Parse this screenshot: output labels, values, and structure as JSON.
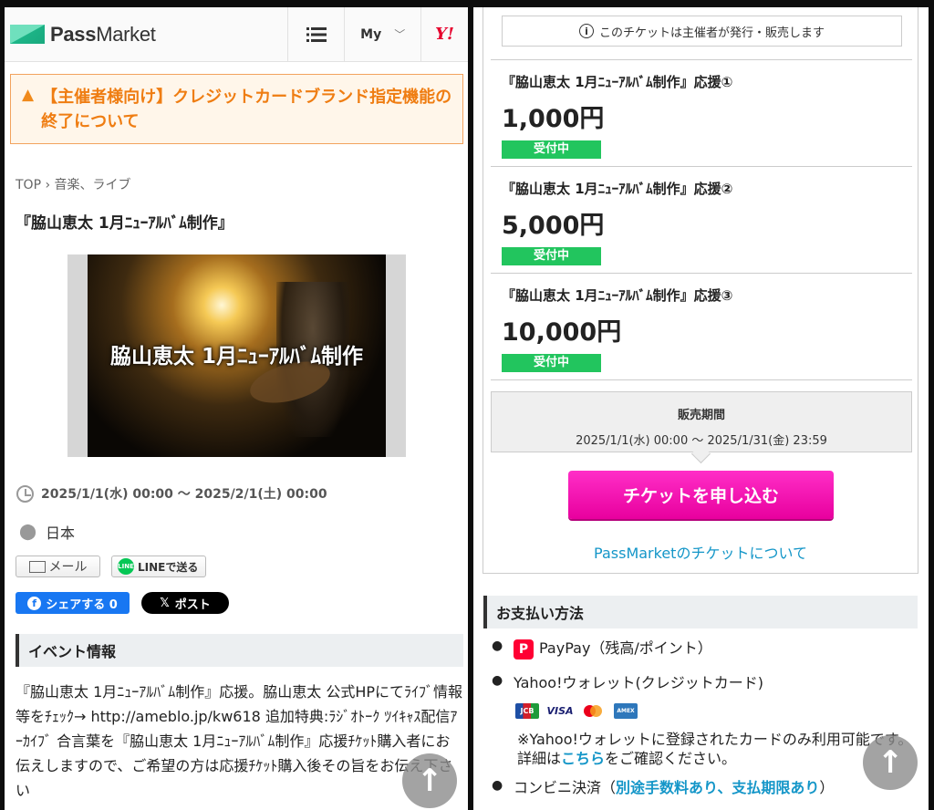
{
  "left": {
    "header": {
      "logo_bold": "Pass",
      "logo_regular": "Market",
      "menu_icon": "list-icon",
      "my_label": "My",
      "yahoo_label": "Y!"
    },
    "notice": "【主催者様向け】クレジットカードブランド指定機能の終了について",
    "breadcrumb": {
      "top": "TOP",
      "sep": "›",
      "category": "音楽、ライブ"
    },
    "event_title": "『脇山恵太 1月ﾆｭｰｱﾙﾊﾞﾑ制作』",
    "hero_caption": "脇山恵太 1月ﾆｭｰｱﾙﾊﾞﾑ制作",
    "datetime": "2025/1/1(水) 00:00 〜 2025/2/1(土) 00:00",
    "location": "日本",
    "share": {
      "mail": "メール",
      "line": "LINEで送る",
      "line_icon_text": "LINE",
      "facebook": "シェアする 0",
      "x": "ポスト"
    },
    "section_title": "イベント情報",
    "description": "『脇山恵太 1月ﾆｭｰｱﾙﾊﾞﾑ制作』応援。脇山恵太 公式HPにてﾗｲﾌﾞ情報等をﾁｪｯｸ→ http://ameblo.jp/kw618 追加特典:ﾗｼﾞｵﾄｰｸ ﾂｲｷｬｽ配信ｱｰｶｲﾌﾞ 合言葉を『脇山恵太 1月ﾆｭｰｱﾙﾊﾞﾑ制作』応援ﾁｹｯﾄ購入者にお伝えしますので、ご希望の方は応援ﾁｹｯﾄ購入後その旨をお伝え下さい"
  },
  "right": {
    "issuer_note": "このチケットは主催者が発行・販売します",
    "tickets": [
      {
        "name": "『脇山恵太 1月ﾆｭｰｱﾙﾊﾞﾑ制作』応援①",
        "price": "1,000円",
        "status": "受付中"
      },
      {
        "name": "『脇山恵太 1月ﾆｭｰｱﾙﾊﾞﾑ制作』応援②",
        "price": "5,000円",
        "status": "受付中"
      },
      {
        "name": "『脇山恵太 1月ﾆｭｰｱﾙﾊﾞﾑ制作』応援③",
        "price": "10,000円",
        "status": "受付中"
      }
    ],
    "sale_period_label": "販売期間",
    "sale_period_value": "2025/1/1(水) 00:00 〜 2025/1/31(金) 23:59",
    "apply_button": "チケットを申し込む",
    "about_link": "PassMarketのチケットについて",
    "payment_title": "お支払い方法",
    "payment": {
      "paypay": "PayPay（残高/ポイント）",
      "yahoo_wallet": "Yahoo!ウォレット(クレジットカード)",
      "cards": [
        "JCB",
        "VISA",
        "Mastercard",
        "AMEX"
      ],
      "note_before": "※Yahoo!ウォレットに登録されたカードのみ利用可能です。詳細は",
      "note_link": "こちら",
      "note_after": "をご確認ください。",
      "convenience": "コンビニ決済（",
      "convenience_link": "別途手数料あり、支払期限あり",
      "convenience_end": "）"
    }
  },
  "colors": {
    "brand_green": "#1fbf8f",
    "apply_pink": "#f40bb4",
    "status_green": "#22c55e",
    "link_blue": "#1496c8",
    "notice_orange": "#ef7d12"
  }
}
